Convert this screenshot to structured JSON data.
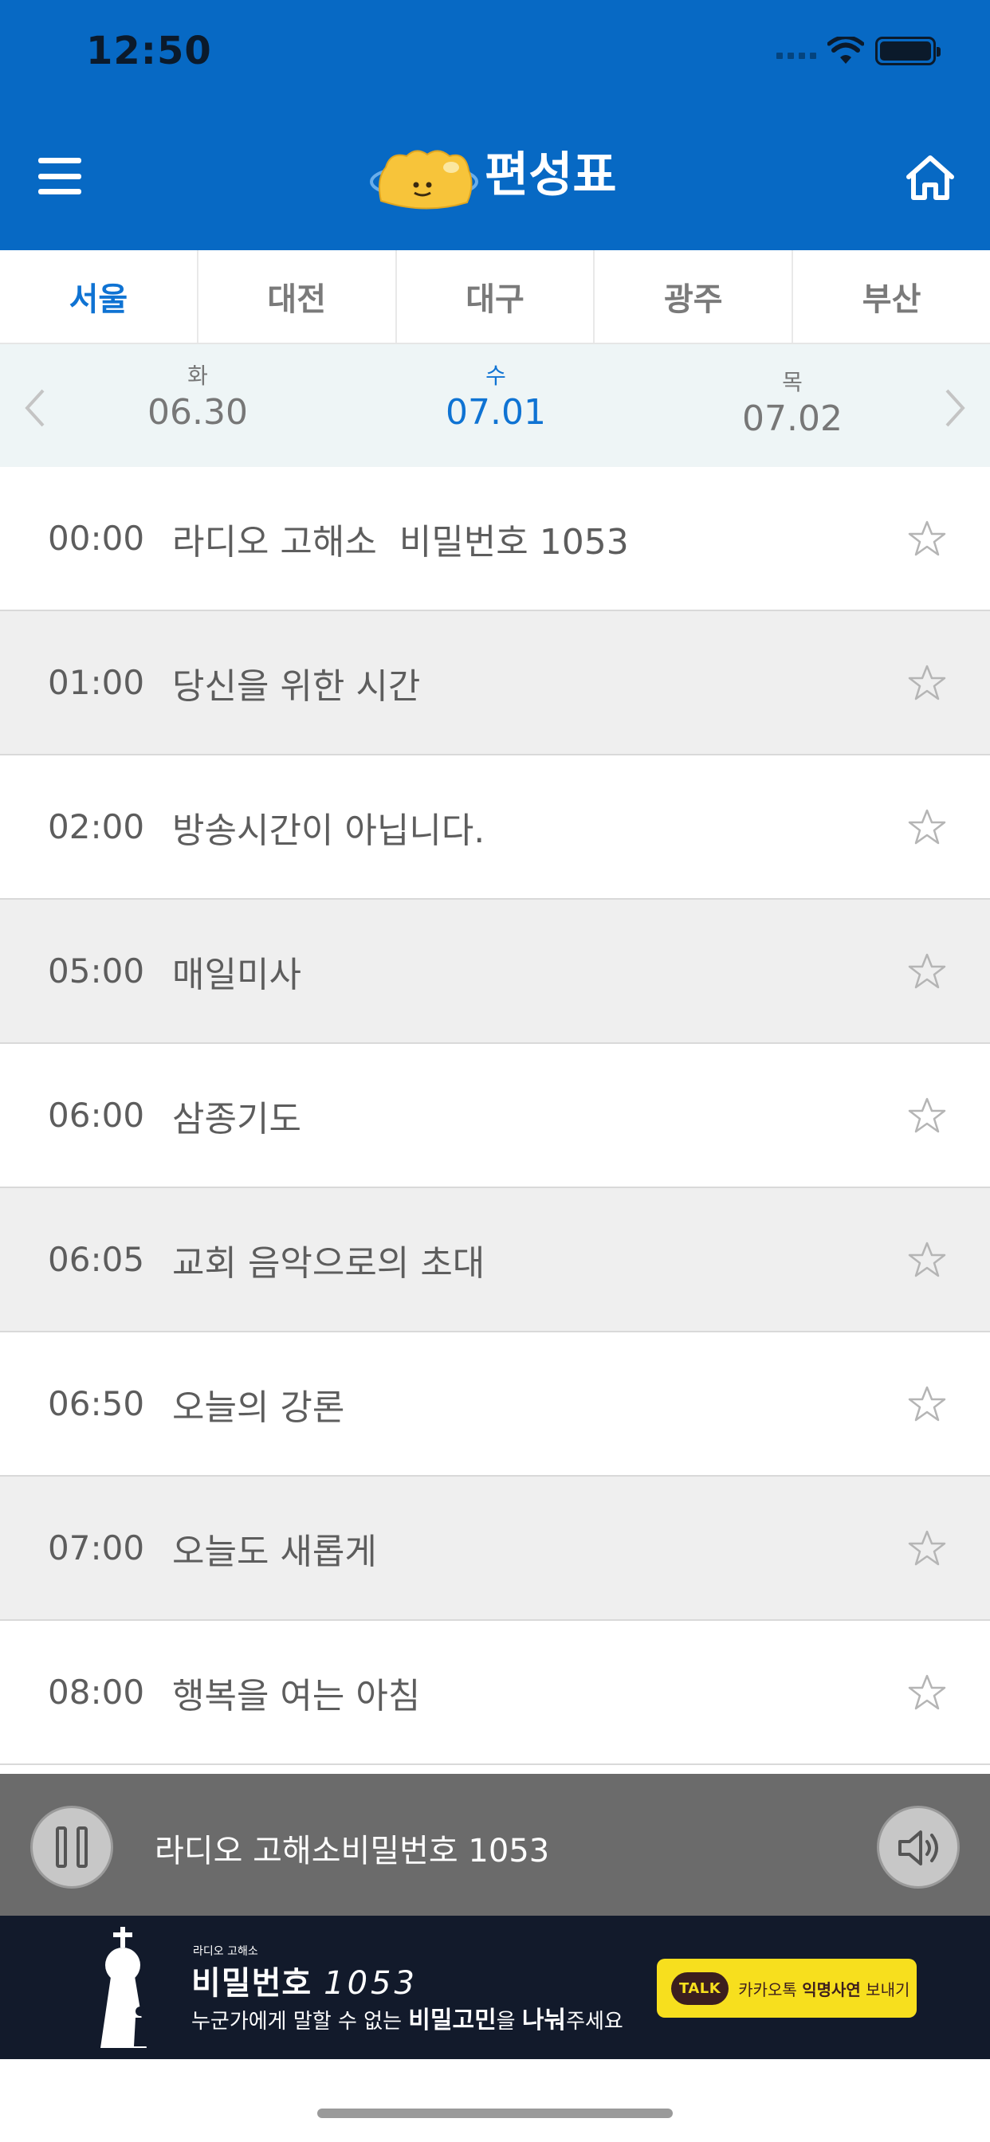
{
  "status_bar": {
    "time": "12:50"
  },
  "header": {
    "title": "편성표"
  },
  "tabs": [
    {
      "label": "서울",
      "active": true
    },
    {
      "label": "대전",
      "active": false
    },
    {
      "label": "대구",
      "active": false
    },
    {
      "label": "광주",
      "active": false
    },
    {
      "label": "부산",
      "active": false
    }
  ],
  "dates": [
    {
      "dow": "화",
      "md": "06.30"
    },
    {
      "dow": "수",
      "md": "07.01",
      "active": true
    },
    {
      "dow": "목",
      "md": "07.02"
    }
  ],
  "schedule": [
    {
      "time": "00:00",
      "program": "라디오 고해소  비밀번호 1053"
    },
    {
      "time": "01:00",
      "program": "당신을 위한 시간"
    },
    {
      "time": "02:00",
      "program": "방송시간이 아닙니다."
    },
    {
      "time": "05:00",
      "program": "매일미사"
    },
    {
      "time": "06:00",
      "program": "삼종기도"
    },
    {
      "time": "06:05",
      "program": "교회 음악으로의 초대"
    },
    {
      "time": "06:50",
      "program": "오늘의 강론"
    },
    {
      "time": "07:00",
      "program": "오늘도 새롭게"
    },
    {
      "time": "08:00",
      "program": "행복을 여는 아침"
    }
  ],
  "player": {
    "now_playing": "라디오 고해소비밀번호 1053"
  },
  "banner": {
    "small": "라디오 고해소",
    "headline_prefix": "비밀번호 ",
    "headline_number": "1053",
    "sub_1": "누군가에게 말할 수 없는 ",
    "sub_bold_1": "비밀고민",
    "sub_2": "을 ",
    "sub_bold_2": "나눠",
    "sub_3": "주세요",
    "kakao_talk": "TALK",
    "kakao_text_1": "카카오톡 ",
    "kakao_text_bold": "익명사연",
    "kakao_text_2": " 보내기"
  },
  "colors": {
    "header_blue": "#0769c4",
    "accent_blue": "#0f73d3",
    "date_bar": "#eef5f6",
    "row_alt": "#efefef",
    "player_bg": "#6b6b6b",
    "banner_bg": "#121a2b",
    "kakao_yellow": "#f7df1e"
  },
  "icons": {
    "menu": "hamburger-menu-icon",
    "home": "home-icon",
    "star": "star-outline-icon",
    "pause": "pause-icon",
    "volume": "speaker-icon"
  }
}
